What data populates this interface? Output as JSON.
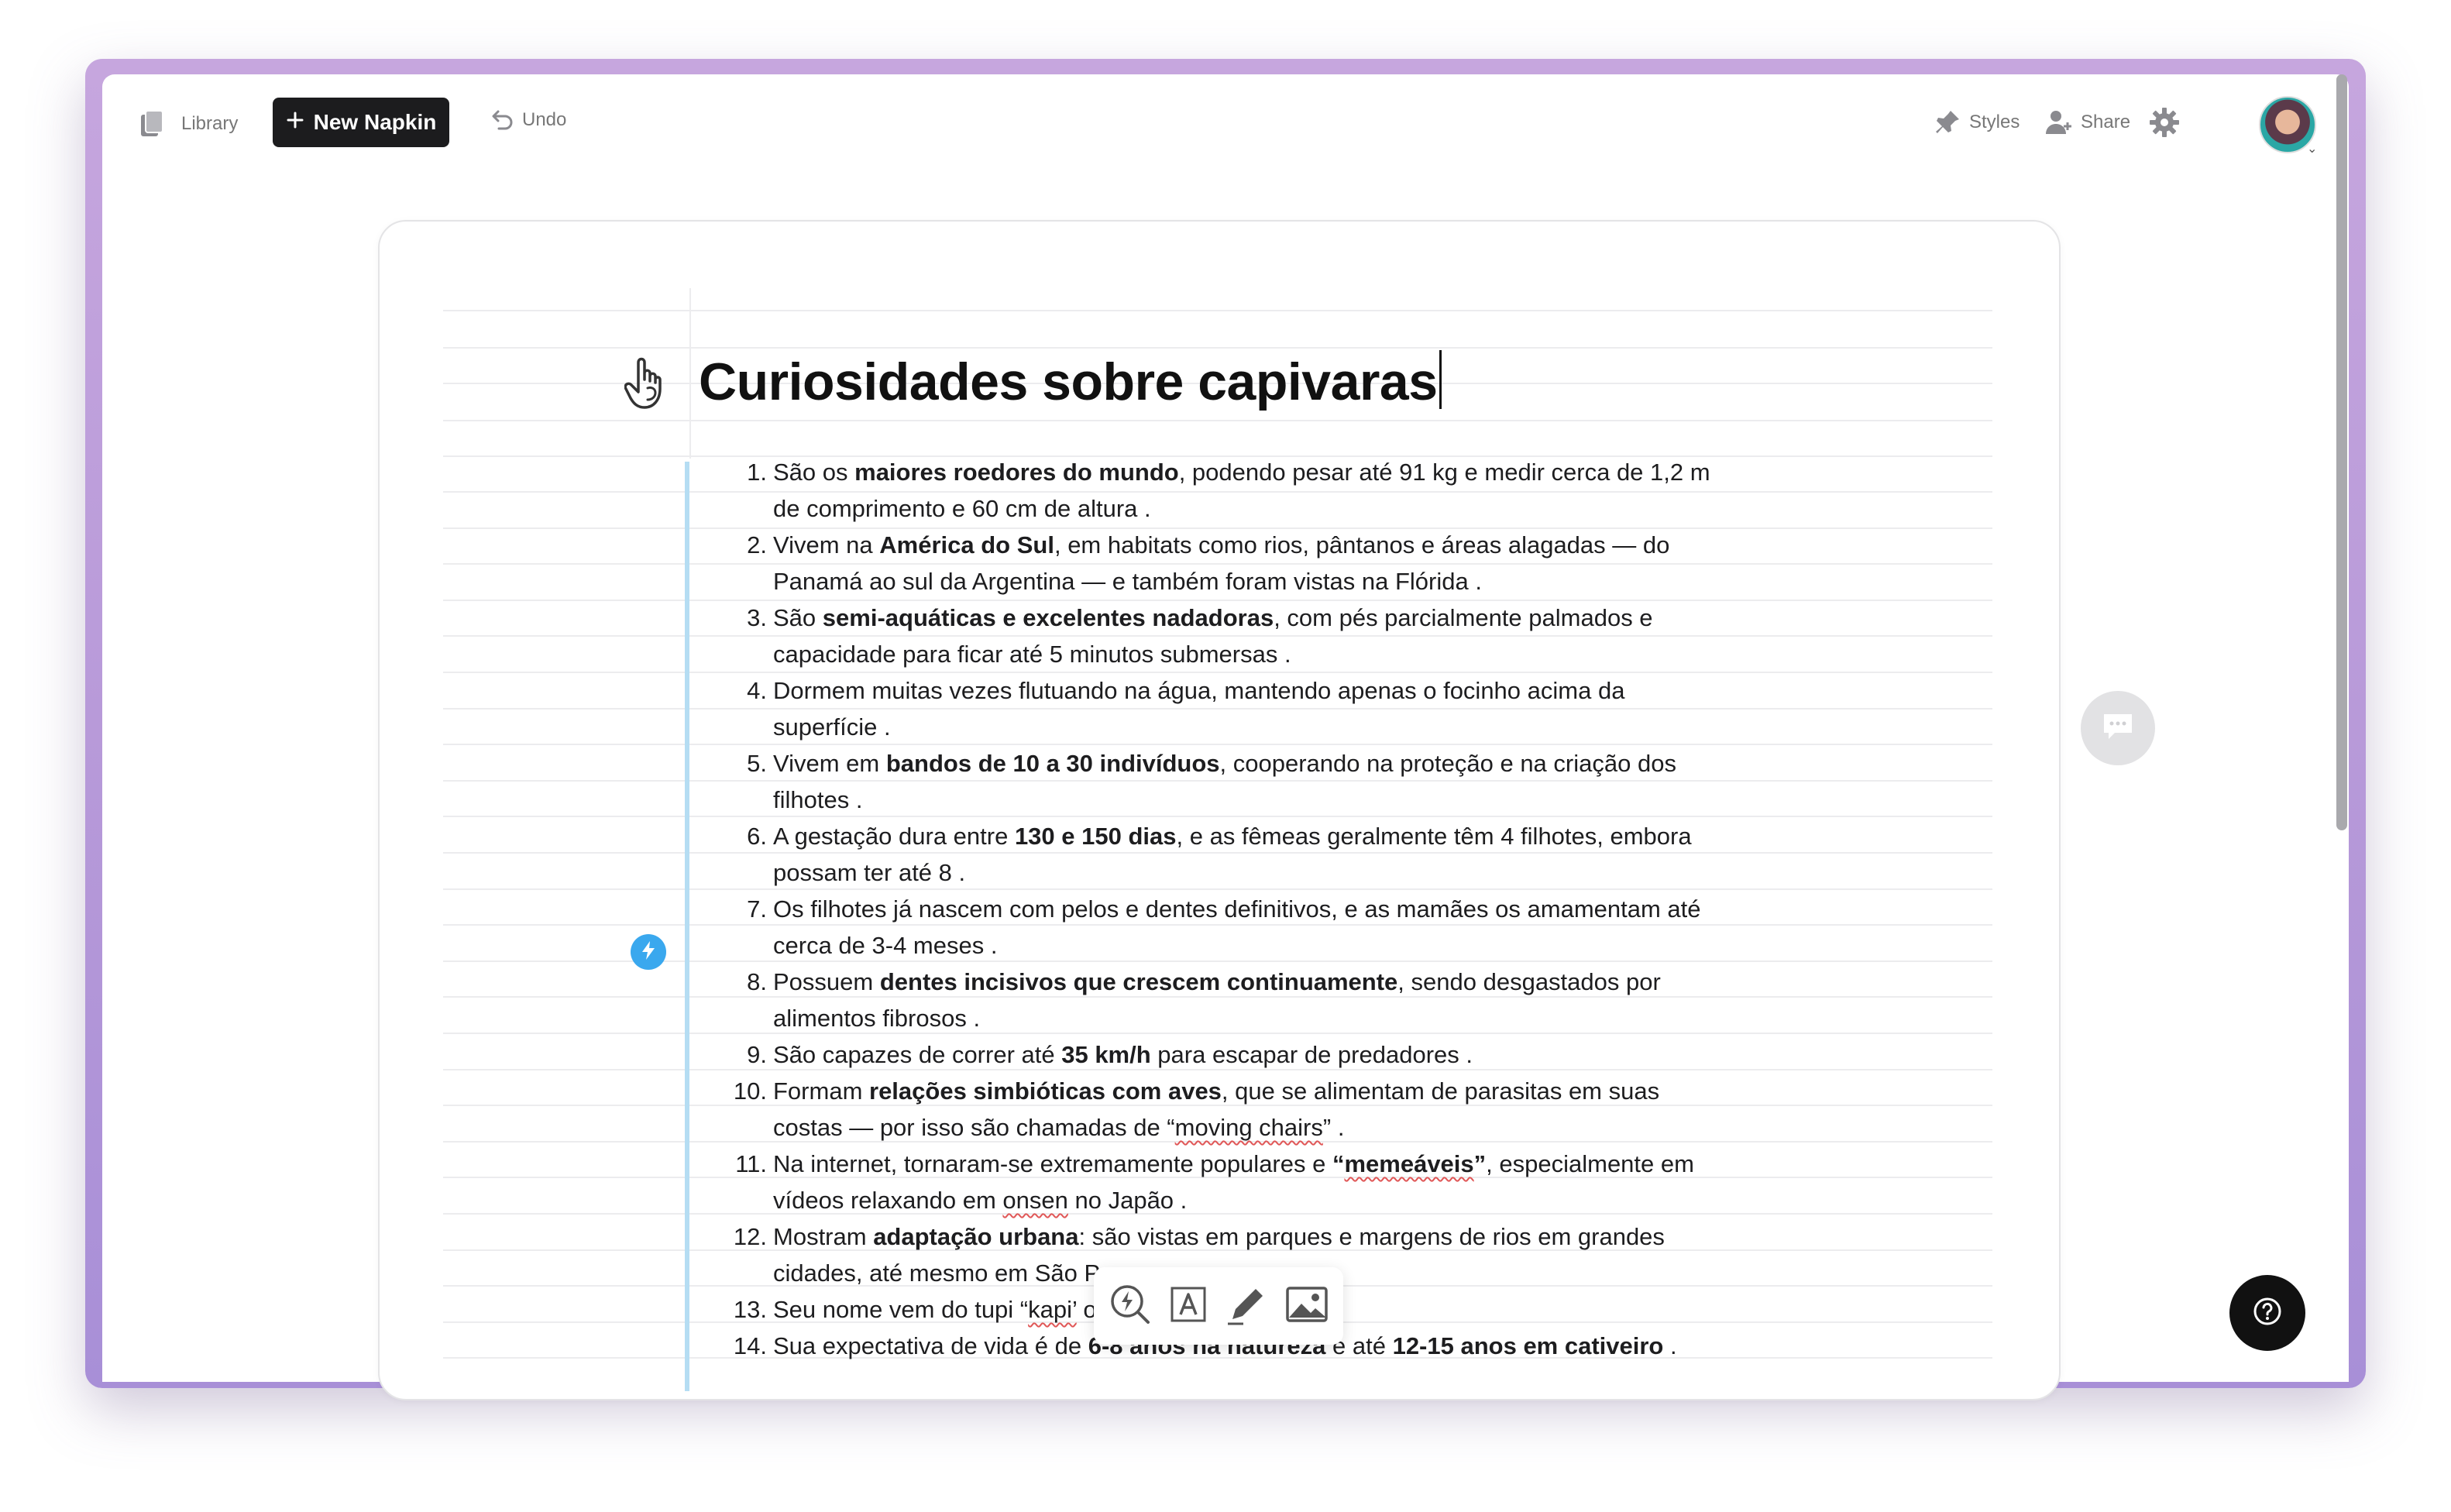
{
  "toolbar": {
    "library_label": "Library",
    "new_napkin_label": "New Napkin",
    "undo_label": "Undo",
    "styles_label": "Styles",
    "share_label": "Share"
  },
  "document": {
    "title": "Curiosidades sobre capivaras",
    "items": [
      {
        "num": "1.",
        "lines": [
          [
            {
              "t": "São os "
            },
            {
              "t": "maiores roedores do mundo",
              "b": true
            },
            {
              "t": ", podendo pesar até 91 kg e medir cerca de 1,2 m"
            }
          ],
          [
            {
              "t": "de comprimento e 60 cm de altura  ."
            }
          ]
        ]
      },
      {
        "num": "2.",
        "lines": [
          [
            {
              "t": "Vivem na "
            },
            {
              "t": "América do Sul",
              "b": true
            },
            {
              "t": ", em habitats como rios, pântanos e áreas alagadas — do"
            }
          ],
          [
            {
              "t": "Panamá ao sul da Argentina — e também foram vistas na Flórida  ."
            }
          ]
        ]
      },
      {
        "num": "3.",
        "lines": [
          [
            {
              "t": "São "
            },
            {
              "t": "semi-aquáticas e excelentes nadadoras",
              "b": true
            },
            {
              "t": ", com pés parcialmente palmados e"
            }
          ],
          [
            {
              "t": "capacidade para ficar até 5 minutos submersas  ."
            }
          ]
        ]
      },
      {
        "num": "4.",
        "lines": [
          [
            {
              "t": "Dormem muitas vezes flutuando na água, mantendo apenas o focinho acima da"
            }
          ],
          [
            {
              "t": "superfície ."
            }
          ]
        ]
      },
      {
        "num": "5.",
        "lines": [
          [
            {
              "t": "Vivem em "
            },
            {
              "t": "bandos de 10 a 30 indivíduos",
              "b": true
            },
            {
              "t": ", cooperando na proteção e na criação dos"
            }
          ],
          [
            {
              "t": "filhotes  ."
            }
          ]
        ]
      },
      {
        "num": "6.",
        "lines": [
          [
            {
              "t": "A gestação dura entre "
            },
            {
              "t": "130 e 150 dias",
              "b": true
            },
            {
              "t": ", e as fêmeas geralmente têm 4 filhotes, embora"
            }
          ],
          [
            {
              "t": "possam ter até 8  ."
            }
          ]
        ]
      },
      {
        "num": "7.",
        "lines": [
          [
            {
              "t": "Os filhotes já nascem com pelos e dentes definitivos, e as mamães os amamentam até"
            }
          ],
          [
            {
              "t": "cerca de 3-4 meses  ."
            }
          ]
        ]
      },
      {
        "num": "8.",
        "lines": [
          [
            {
              "t": "Possuem "
            },
            {
              "t": "dentes incisivos que crescem continuamente",
              "b": true
            },
            {
              "t": ", sendo desgastados por"
            }
          ],
          [
            {
              "t": "alimentos fibrosos  ."
            }
          ]
        ]
      },
      {
        "num": "9.",
        "lines": [
          [
            {
              "t": "São capazes de correr até "
            },
            {
              "t": "35 km/h",
              "b": true
            },
            {
              "t": " para escapar de predadores  ."
            }
          ]
        ]
      },
      {
        "num": "10.",
        "lines": [
          [
            {
              "t": "Formam "
            },
            {
              "t": "relações simbióticas com aves",
              "b": true
            },
            {
              "t": ", que se alimentam de parasitas em suas"
            }
          ],
          [
            {
              "t": "costas — por isso são chamadas de “"
            },
            {
              "t": "moving chairs",
              "sq": true
            },
            {
              "t": "”  ."
            }
          ]
        ]
      },
      {
        "num": "11.",
        "lines": [
          [
            {
              "t": "Na internet, tornaram-se extremamente populares e "
            },
            {
              "t": "“",
              "b": true
            },
            {
              "t": "memeáveis",
              "b": true,
              "sq": true
            },
            {
              "t": "”",
              "b": true
            },
            {
              "t": ", especialmente em"
            }
          ],
          [
            {
              "t": "vídeos relaxando em "
            },
            {
              "t": "onsen",
              "sq": true
            },
            {
              "t": " no Japão ."
            }
          ]
        ]
      },
      {
        "num": "12.",
        "lines": [
          [
            {
              "t": "Mostram "
            },
            {
              "t": "adaptação urbana",
              "b": true
            },
            {
              "t": ": são vistas em parques e margens de rios em grandes"
            }
          ],
          [
            {
              "t": "cidades, até mesmo em São P"
            }
          ]
        ]
      },
      {
        "num": "13.",
        "lines": [
          [
            {
              "t": "Seu nome vem do tupi “"
            },
            {
              "t": "kapi’",
              "sq": true
            },
            {
              "t": "                          omedor de capim”  ."
            }
          ]
        ]
      },
      {
        "num": "14.",
        "lines": [
          [
            {
              "t": "Sua expectativa de vida é de "
            },
            {
              "t": "6-8 anos na natureza",
              "b": true
            },
            {
              "t": " e até "
            },
            {
              "t": "12-15 anos em cativeiro",
              "b": true
            },
            {
              "t": "  ."
            }
          ]
        ]
      }
    ]
  },
  "icons": {
    "library": "library-icon",
    "new_napkin": "plus-icon",
    "undo": "undo-icon",
    "styles": "pin-icon",
    "share": "add-user-icon",
    "settings": "gear-icon",
    "title": "napkin-hand-icon",
    "bolt": "bolt-icon",
    "comment": "comment-icon",
    "help": "help-icon",
    "float_toolbar": [
      "bolt-search-icon",
      "text-box-icon",
      "pencil-icon",
      "image-icon"
    ]
  },
  "colors": {
    "frame": "#b89ad9",
    "accent_line": "#b5ddf3",
    "bolt_dot": "#3aa8ee",
    "primary_button": "#1c1c1e"
  }
}
